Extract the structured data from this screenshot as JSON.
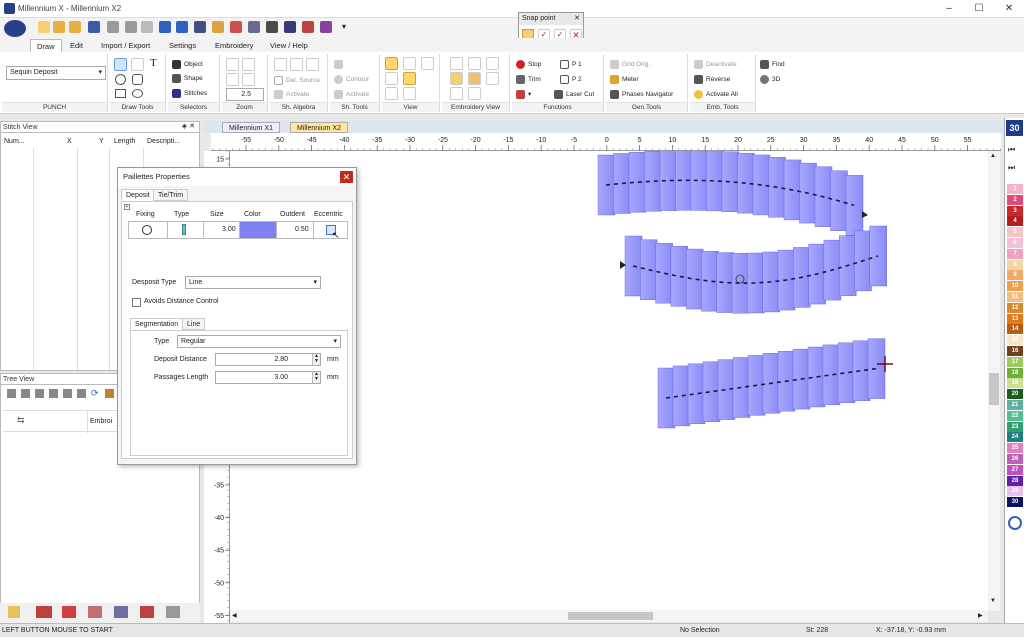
{
  "window": {
    "title": "Millennium X - Millennium X2"
  },
  "ribbon": {
    "tabs": [
      "Draw",
      "Edit",
      "Import / Export",
      "Settings",
      "Embroidery",
      "View / Help"
    ],
    "active_tab": "Draw",
    "punch": {
      "dropdown_value": "Sequin Deposit",
      "title": "PUNCH"
    },
    "draw_tools": {
      "title": "Draw Tools"
    },
    "selectors": {
      "object": "Object",
      "shape": "Shape",
      "stitches": "Stitches",
      "title": "Selectors"
    },
    "zoom": {
      "value": "2.5",
      "title": "Zoom"
    },
    "sh_algebra": {
      "del_source": "Del. Source",
      "activate": "Activate",
      "title": "Sh. Algebra"
    },
    "sh_tools": {
      "contour": "Contour",
      "activate": "Activate",
      "title": "Sh. Tools"
    },
    "view": {
      "title": "View"
    },
    "embroidery_view": {
      "title": "Embroidery View"
    },
    "functions": {
      "stop": "Stop",
      "p1": "P 1",
      "trim": "Trim",
      "p2": "P 2",
      "laser_cut": "Laser Cut",
      "title": "Functions"
    },
    "gen_tools": {
      "grid_orig": "Grid Orig.",
      "meter": "Meter",
      "phases": "Phases Navigator",
      "title": "Gen.Tools"
    },
    "emb_tools": {
      "deactivate": "Deactivate",
      "reverse": "Reverse",
      "activate_all": "Activate All",
      "title": "Emb. Tools"
    },
    "find": {
      "find": "Find",
      "three_d": "3D"
    }
  },
  "snap_point": {
    "title": "Snap point"
  },
  "stitch_view": {
    "title": "Stitch View",
    "columns": [
      "Num...",
      "X",
      "Y",
      "Length",
      "Descripti..."
    ]
  },
  "tree_view": {
    "title": "Tree View",
    "row_label": "Embroi"
  },
  "document_tabs": [
    "Millennium X1",
    "Millennium X2"
  ],
  "active_document": "Millennium X2",
  "ruler": {
    "h_labels": [
      "-55",
      "-50",
      "-45",
      "-40",
      "-35",
      "-30",
      "-25",
      "-20",
      "-15",
      "-10",
      "-5",
      "0",
      "5",
      "10",
      "15",
      "20",
      "25",
      "30",
      "35",
      "40",
      "45",
      "50",
      "55"
    ],
    "v_labels": [
      "15",
      "10",
      "5",
      "0",
      "-5",
      "-10",
      "-15",
      "-20",
      "-25",
      "-30",
      "-35",
      "-40",
      "-45",
      "-50",
      "-55"
    ]
  },
  "palette": {
    "top_number": "30",
    "swatches": [
      {
        "n": "1",
        "color": "#f4b4c8"
      },
      {
        "n": "2",
        "color": "#e0497a"
      },
      {
        "n": "3",
        "color": "#cc2a2a"
      },
      {
        "n": "4",
        "color": "#b51c1c"
      },
      {
        "n": "5",
        "color": "#f5c6c6"
      },
      {
        "n": "6",
        "color": "#f4c0d4"
      },
      {
        "n": "7",
        "color": "#f2a0c0"
      },
      {
        "n": "8",
        "color": "#f0d6a0"
      },
      {
        "n": "9",
        "color": "#f2a868"
      },
      {
        "n": "10",
        "color": "#eea050"
      },
      {
        "n": "11",
        "color": "#f0c080"
      },
      {
        "n": "12",
        "color": "#d68a30"
      },
      {
        "n": "13",
        "color": "#e07a20"
      },
      {
        "n": "14",
        "color": "#b85c10"
      },
      {
        "n": "15",
        "color": "#f4e8c8"
      },
      {
        "n": "16",
        "color": "#704020"
      },
      {
        "n": "17",
        "color": "#9ccc60"
      },
      {
        "n": "18",
        "color": "#70b040"
      },
      {
        "n": "19",
        "color": "#c8e090"
      },
      {
        "n": "20",
        "color": "#205a20"
      },
      {
        "n": "21",
        "color": "#60b0a0"
      },
      {
        "n": "22",
        "color": "#50c090"
      },
      {
        "n": "23",
        "color": "#30a070"
      },
      {
        "n": "24",
        "color": "#208080"
      },
      {
        "n": "25",
        "color": "#e080c0"
      },
      {
        "n": "26",
        "color": "#c060b0"
      },
      {
        "n": "27",
        "color": "#c050c0"
      },
      {
        "n": "28",
        "color": "#6020a0"
      },
      {
        "n": "29",
        "color": "#e8c0f0"
      },
      {
        "n": "30",
        "color": "#101060"
      }
    ]
  },
  "dialog": {
    "title": "Paillettes Properties",
    "tabs": [
      "Deposit",
      "Tie/Trim"
    ],
    "table_headers": [
      "Fixing",
      "Type",
      "Size",
      "Color",
      "Outdent",
      "Eccentric"
    ],
    "row": {
      "size": "3.00",
      "color": "#8080f0",
      "outdent": "0.50"
    },
    "desposit_type_label": "Desposit Type",
    "desposit_type_value": "Line",
    "avoids_distance": "Avoids Distance Control",
    "seg_tabs": [
      "Segmentation",
      "Line"
    ],
    "type_label": "Type",
    "type_value": "Regular",
    "deposit_distance_label": "Deposit Distance",
    "deposit_distance_value": "2.80",
    "passages_length_label": "Passages Length",
    "passages_length_value": "3.00",
    "unit": "mm"
  },
  "status": {
    "hint": "LEFT BUTTON MOUSE TO START",
    "selection": "No Selection",
    "stitches": "St: 228",
    "coords": "X: -37.18, Y: -0.93 mm"
  },
  "colors": {
    "sequin": "#8a8af5",
    "sequin_edge": "#5a5ae0",
    "accent": "#1e3c8c"
  }
}
